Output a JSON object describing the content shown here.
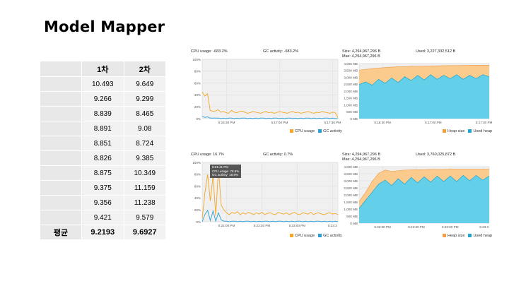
{
  "slide": {
    "title": "Model Mapper"
  },
  "table": {
    "headers": [
      "",
      "1차",
      "2차"
    ],
    "rows": [
      [
        "",
        "10.493",
        "9.649"
      ],
      [
        "",
        "9.266",
        "9.299"
      ],
      [
        "",
        "8.839",
        "8.465"
      ],
      [
        "",
        "8.891",
        "9.08"
      ],
      [
        "",
        "8.851",
        "8.724"
      ],
      [
        "",
        "8.826",
        "9.385"
      ],
      [
        "",
        "8.875",
        "10.349"
      ],
      [
        "",
        "9.375",
        "11.159"
      ],
      [
        "",
        "9.356",
        "11.238"
      ],
      [
        "",
        "9.421",
        "9.579"
      ]
    ],
    "average": {
      "label": "평균",
      "v1": "9.2193",
      "v2": "9.6927"
    }
  },
  "colors": {
    "cpu": "#f5a623",
    "gc": "#2a9fd6",
    "heap": "#fbcb8e",
    "heap_line": "#f0a050",
    "used": "#64cfe8",
    "used_line": "#1fa6cc",
    "plot_bg": "#f0f0f0"
  },
  "cpu_panels": [
    {
      "header_left": "CPU usage: -683.2%",
      "header_right": "GC activity: -683.2%",
      "y_ticks": [
        "100%",
        "80%",
        "60%",
        "40%",
        "20%",
        "0%"
      ],
      "x_ticks": [
        "5:16:30 PM",
        "5:17:00 PM",
        "5:17:30 PM"
      ],
      "legend": [
        "CPU usage",
        "GC activity"
      ]
    },
    {
      "header_left": "CPU usage: 16.7%",
      "header_right": "GC activity: 0.7%",
      "y_ticks": [
        "100%",
        "80%",
        "60%",
        "40%",
        "20%",
        "0%"
      ],
      "x_ticks": [
        "5:22:00 PM",
        "5:22:30 PM",
        "5:23:00 PM",
        "5:23:3"
      ],
      "legend": [
        "CPU usage",
        "GC activity"
      ],
      "tooltip": [
        "5:21:41 PM",
        "CPU usage  78.6%",
        "GC activity  18.9%"
      ]
    }
  ],
  "heap_panels": [
    {
      "size_label": "Size: 4,294,967,296 B",
      "used_label": "Used: 3,227,332,512 B",
      "max_label": "Max: 4,294,967,296 B",
      "y_ticks": [
        "4,000 MB",
        "3,500 MB",
        "3,000 MB",
        "2,500 MB",
        "2,000 MB",
        "1,500 MB",
        "1,000 MB",
        "500 MB",
        "0 MB"
      ],
      "x_ticks": [
        "5:16:30 PM",
        "5:17:00 PM",
        "5:17:30 PM"
      ],
      "legend": [
        "Heap size",
        "Used heap"
      ]
    },
    {
      "size_label": "Size: 4,294,967,296 B",
      "used_label": "Used: 3,760,025,872 B",
      "max_label": "Max: 4,294,967,296 B",
      "y_ticks": [
        "4,000 MB",
        "3,500 MB",
        "3,000 MB",
        "2,500 MB",
        "2,000 MB",
        "1,500 MB",
        "1,000 MB",
        "500 MB",
        "0 MB"
      ],
      "x_ticks": [
        "5:22:00 PM",
        "5:22:30 PM",
        "5:23:00 PM",
        "5:23:3"
      ],
      "legend": [
        "Heap size",
        "Used heap"
      ]
    }
  ],
  "chart_data": [
    {
      "type": "line",
      "ylim": [
        0,
        100
      ],
      "series": [
        {
          "name": "CPU usage",
          "values": [
            45,
            38,
            42,
            14,
            12,
            13,
            15,
            11,
            12,
            10,
            9,
            14,
            11,
            10,
            12,
            13,
            11,
            9,
            10,
            12,
            11,
            10,
            9,
            11,
            12,
            10,
            11,
            9,
            10,
            12,
            11,
            10,
            9,
            11,
            12,
            10,
            11,
            9,
            10,
            11,
            12,
            10,
            9,
            11,
            10,
            12,
            11,
            10,
            9,
            11,
            10,
            2
          ]
        },
        {
          "name": "GC activity",
          "values": [
            4,
            2,
            3,
            1,
            1,
            1,
            1,
            0,
            1,
            0,
            1,
            1,
            0,
            1,
            0,
            1,
            1,
            0,
            1,
            0,
            1,
            0,
            1,
            1,
            0,
            1,
            0,
            1,
            1,
            0,
            1,
            0,
            1,
            1,
            0,
            1,
            0,
            1,
            0,
            1,
            1,
            0,
            1,
            0,
            1,
            0,
            1,
            1,
            0,
            1,
            0,
            0
          ]
        }
      ]
    },
    {
      "type": "line",
      "ylim": [
        0,
        100
      ],
      "series": [
        {
          "name": "CPU usage",
          "values": [
            5,
            48,
            80,
            35,
            78,
            10,
            90,
            28,
            20,
            15,
            12,
            16,
            14,
            17,
            12,
            15,
            13,
            16,
            14,
            12,
            15,
            13,
            16,
            12,
            14,
            15,
            13,
            12,
            16,
            14,
            13,
            15,
            12,
            14,
            16,
            13,
            12,
            15,
            14,
            13,
            16,
            12,
            14,
            15,
            13,
            12,
            14,
            15,
            13,
            14,
            12
          ]
        },
        {
          "name": "GC activity",
          "values": [
            0,
            12,
            19,
            2,
            18,
            1,
            15,
            3,
            1,
            1,
            0,
            1,
            1,
            0,
            1,
            0,
            1,
            1,
            0,
            1,
            0,
            1,
            0,
            1,
            1,
            0,
            1,
            0,
            1,
            1,
            0,
            1,
            0,
            1,
            0,
            1,
            1,
            0,
            1,
            0,
            1,
            0,
            1,
            1,
            0,
            1,
            0,
            1,
            0,
            1,
            0
          ]
        }
      ]
    },
    {
      "type": "area",
      "ylim": [
        0,
        4200
      ],
      "series": [
        {
          "name": "Heap size",
          "values": [
            3700,
            3760,
            3820,
            3860,
            3900,
            3930,
            3950,
            3970,
            3990,
            4000,
            4010,
            4020,
            4030,
            4040,
            4050,
            4050,
            4060,
            4060,
            4070,
            4070,
            4070
          ]
        },
        {
          "name": "Used heap",
          "values": [
            2600,
            2800,
            2550,
            3000,
            2700,
            3100,
            2750,
            3200,
            2900,
            3300,
            2950,
            3350,
            3000,
            3300,
            3050,
            3350,
            3000,
            3300,
            3050,
            3350,
            3200
          ]
        }
      ]
    },
    {
      "type": "area",
      "ylim": [
        0,
        4200
      ],
      "series": [
        {
          "name": "Heap size",
          "values": [
            1600,
            2300,
            3100,
            3700,
            3950,
            3850,
            3900,
            3950,
            3960,
            3970,
            3980,
            3990,
            4000,
            4000,
            4010,
            4010,
            4010,
            4010,
            4010,
            4010,
            4010
          ]
        },
        {
          "name": "Used heap",
          "values": [
            1100,
            1700,
            2300,
            2900,
            3200,
            2800,
            3300,
            2900,
            3400,
            3000,
            3450,
            3050,
            3500,
            3100,
            3500,
            3100,
            3550,
            3150,
            3550,
            3200,
            3500
          ]
        }
      ]
    }
  ]
}
